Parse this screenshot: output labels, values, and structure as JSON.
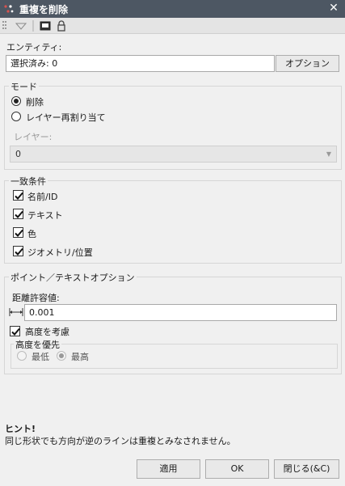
{
  "window": {
    "title": "重複を削除",
    "close_glyph": "✕"
  },
  "entity": {
    "label": "エンティティ:",
    "value": "選択済み: 0",
    "options_button": "オプション"
  },
  "mode": {
    "group_title": "モード",
    "options": [
      {
        "label": "削除",
        "checked": true
      },
      {
        "label": "レイヤー再割り当て",
        "checked": false
      }
    ],
    "layer_label": "レイヤー:",
    "layer_value": "0"
  },
  "match": {
    "group_title": "一致条件",
    "items": [
      {
        "label": "名前/ID",
        "checked": true
      },
      {
        "label": "テキスト",
        "checked": true
      },
      {
        "label": "色",
        "checked": true
      },
      {
        "label": "ジオメトリ/位置",
        "checked": true
      }
    ]
  },
  "point_text": {
    "group_title": "ポイント／テキストオプション",
    "tolerance_label": "距離許容値:",
    "tolerance_value": "0.001",
    "consider_elevation_label": "高度を考慮",
    "consider_elevation_checked": true,
    "priority": {
      "title": "高度を優先",
      "options": [
        {
          "label": "最低",
          "checked": false
        },
        {
          "label": "最高",
          "checked": true
        }
      ]
    }
  },
  "hint": {
    "title": "ヒント!",
    "text": "同じ形状でも方向が逆のラインは重複とみなされません。"
  },
  "footer": {
    "apply": "適用",
    "ok": "OK",
    "close": "閉じる(&C)"
  },
  "colors": {
    "titlebar": "#4d5763",
    "background": "#f0f0f0"
  }
}
